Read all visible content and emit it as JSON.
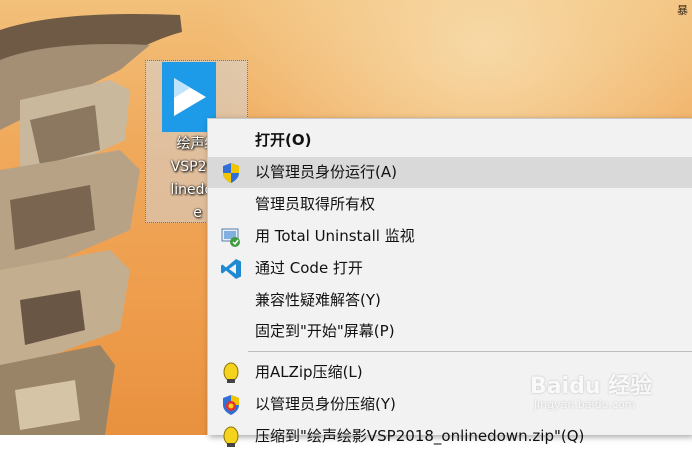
{
  "corner_text": "暴",
  "desktop_icon": {
    "label": "绘声绘\nVSP201\nlinedow\ne",
    "icon": "vsp-play-logo-icon"
  },
  "context_menu": {
    "items": [
      {
        "label": "打开(O)",
        "icon": ""
      },
      {
        "label": "以管理员身份运行(A)",
        "icon": "uac-shield-icon"
      },
      {
        "label": "管理员取得所有权",
        "icon": ""
      },
      {
        "label": "用 Total Uninstall 监视",
        "icon": "total-uninstall-icon"
      },
      {
        "label": "通过 Code 打开",
        "icon": "vscode-icon"
      },
      {
        "label": "兼容性疑难解答(Y)",
        "icon": ""
      },
      {
        "label": "固定到\"开始\"屏幕(P)",
        "icon": ""
      },
      {
        "label": "用ALZip压缩(L)",
        "icon": "alzip-icon"
      },
      {
        "label": "以管理员身份压缩(Y)",
        "icon": "alzip-admin-icon"
      },
      {
        "label": "压缩到\"绘声绘影VSP2018_onlinedown.zip\"(Q)",
        "icon": "alzip-icon"
      }
    ]
  },
  "watermark": {
    "text": "Baidu 经验",
    "sub": "jingyan.baidu.com"
  },
  "colors": {
    "menu_bg": "#f2f2f2",
    "menu_hover": "#d9d9d9",
    "vsp_blue": "#1e9be8",
    "vscode_blue": "#1f8ad2"
  }
}
